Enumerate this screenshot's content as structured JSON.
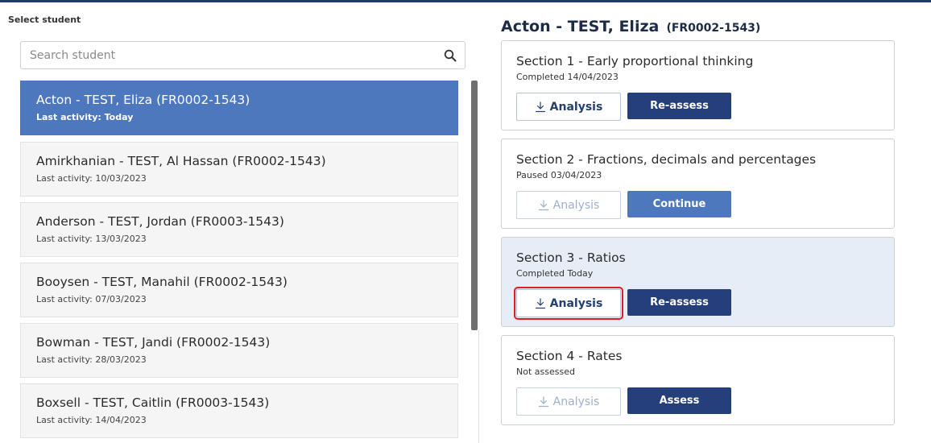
{
  "left_panel": {
    "label": "Select student",
    "search_placeholder": "Search student",
    "students": [
      {
        "name": "Acton - TEST, Eliza (FR0002-1543)",
        "activity": "Last activity: Today",
        "selected": true
      },
      {
        "name": "Amirkhanian - TEST, Al Hassan (FR0002-1543)",
        "activity": "Last activity: 10/03/2023"
      },
      {
        "name": "Anderson - TEST, Jordan (FR0003-1543)",
        "activity": "Last activity: 13/03/2023"
      },
      {
        "name": "Booysen - TEST, Manahil (FR0002-1543)",
        "activity": "Last activity: 07/03/2023"
      },
      {
        "name": "Bowman - TEST, Jandi (FR0002-1543)",
        "activity": "Last activity: 28/03/2023"
      },
      {
        "name": "Boxsell - TEST, Caitlin (FR0003-1543)",
        "activity": "Last activity: 14/04/2023"
      }
    ]
  },
  "right_panel": {
    "student_name": "Acton - TEST, Eliza",
    "student_code": "(FR0002-1543)",
    "sections": [
      {
        "title": "Section 1 - Early proportional thinking",
        "status": "Completed 14/04/2023",
        "analysis_label": "Analysis",
        "analysis_enabled": true,
        "action_label": "Re-assess"
      },
      {
        "title": "Section 2 - Fractions, decimals and percentages",
        "status": "Paused 03/04/2023",
        "analysis_label": "Analysis",
        "analysis_enabled": false,
        "action_label": "Continue"
      },
      {
        "title": "Section 3 - Ratios",
        "status": "Completed Today",
        "analysis_label": "Analysis",
        "analysis_enabled": true,
        "highlighted": true,
        "action_label": "Re-assess"
      },
      {
        "title": "Section 4 - Rates",
        "status": "Not assessed",
        "analysis_label": "Analysis",
        "analysis_enabled": false,
        "action_label": "Assess"
      }
    ]
  },
  "colors": {
    "primary": "#253f7d",
    "selected": "#4d78be",
    "highlight_bg": "#e6edf6",
    "focus_outline": "#e21b23"
  }
}
